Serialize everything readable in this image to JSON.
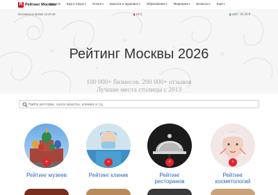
{
  "header": {
    "logo_letter": "R",
    "logo_text": "Рейтинг Москвы",
    "nav": [
      {
        "label": "Новости",
        "caret": false
      },
      {
        "label": "Еда и отдых",
        "caret": true
      },
      {
        "label": "Услуги",
        "caret": true
      },
      {
        "label": "Красота и Здоровье",
        "caret": true
      },
      {
        "label": "Образование",
        "caret": true
      },
      {
        "label": "Медицина",
        "caret": true
      },
      {
        "label": "Бизнесы",
        "caret": true
      },
      {
        "label": "Ещё",
        "caret": true
      }
    ]
  },
  "infobar": {
    "time": "Московское время 13:40:48",
    "weather": "19°C",
    "rates": "USD - 94.26 ₽"
  },
  "hero": {
    "title": "Рейтинг Москвы 2026",
    "stats": "100 000+ бизнесов. 200 000+ отзывов",
    "subtitle": "Лучшие места столицы с 2013"
  },
  "search": {
    "placeholder": "Найти ресторан, салон красоты, клинику и т.д."
  },
  "categories": [
    {
      "label": "Рейтинг музеев",
      "icon": "museum-icon",
      "badge": "+"
    },
    {
      "label": "Рейтинг клиник",
      "icon": "clinic-icon",
      "badge": "+"
    },
    {
      "label": "Рейтинг ресторанов",
      "icon": "restaurant-icon",
      "badge": "+"
    },
    {
      "label": "Рейтинг косметологий",
      "icon": "cosmetology-icon",
      "badge": "+"
    }
  ],
  "colors": {
    "accent": "#d0021b",
    "link": "#2a66b8",
    "badge": "#e0262d"
  }
}
